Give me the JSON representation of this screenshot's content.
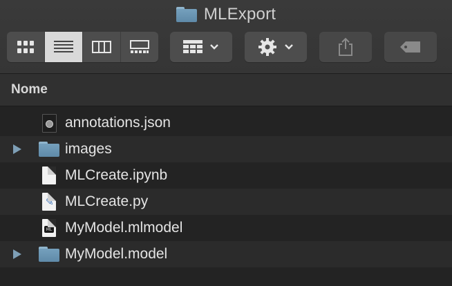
{
  "window": {
    "title": "MLExport"
  },
  "toolbar": {
    "view_modes": [
      {
        "name": "icon-view",
        "icon": "grid-icon",
        "active": false
      },
      {
        "name": "list-view",
        "icon": "list-icon",
        "active": true
      },
      {
        "name": "column-view",
        "icon": "columns-icon",
        "active": false
      },
      {
        "name": "gallery-view",
        "icon": "gallery-icon",
        "active": false
      }
    ],
    "group_icon": "group-by-icon",
    "action_icon": "gear-icon",
    "share_icon": "share-icon",
    "tag_icon": "tag-icon"
  },
  "columns": {
    "name_header": "Nome"
  },
  "files": [
    {
      "name": "annotations.json",
      "kind": "json-file",
      "folder": false
    },
    {
      "name": "images",
      "kind": "folder",
      "folder": true
    },
    {
      "name": "MLCreate.ipynb",
      "kind": "blank-document",
      "folder": false
    },
    {
      "name": "MLCreate.py",
      "kind": "python-file",
      "folder": false
    },
    {
      "name": "MyModel.mlmodel",
      "kind": "mlmodel-file",
      "folder": false,
      "badge": "ML"
    },
    {
      "name": "MyModel.model",
      "kind": "folder",
      "folder": true
    }
  ],
  "colors": {
    "background": "#232323",
    "folder": "#6f9bb9",
    "selected_segment": "#d9d9d9"
  }
}
